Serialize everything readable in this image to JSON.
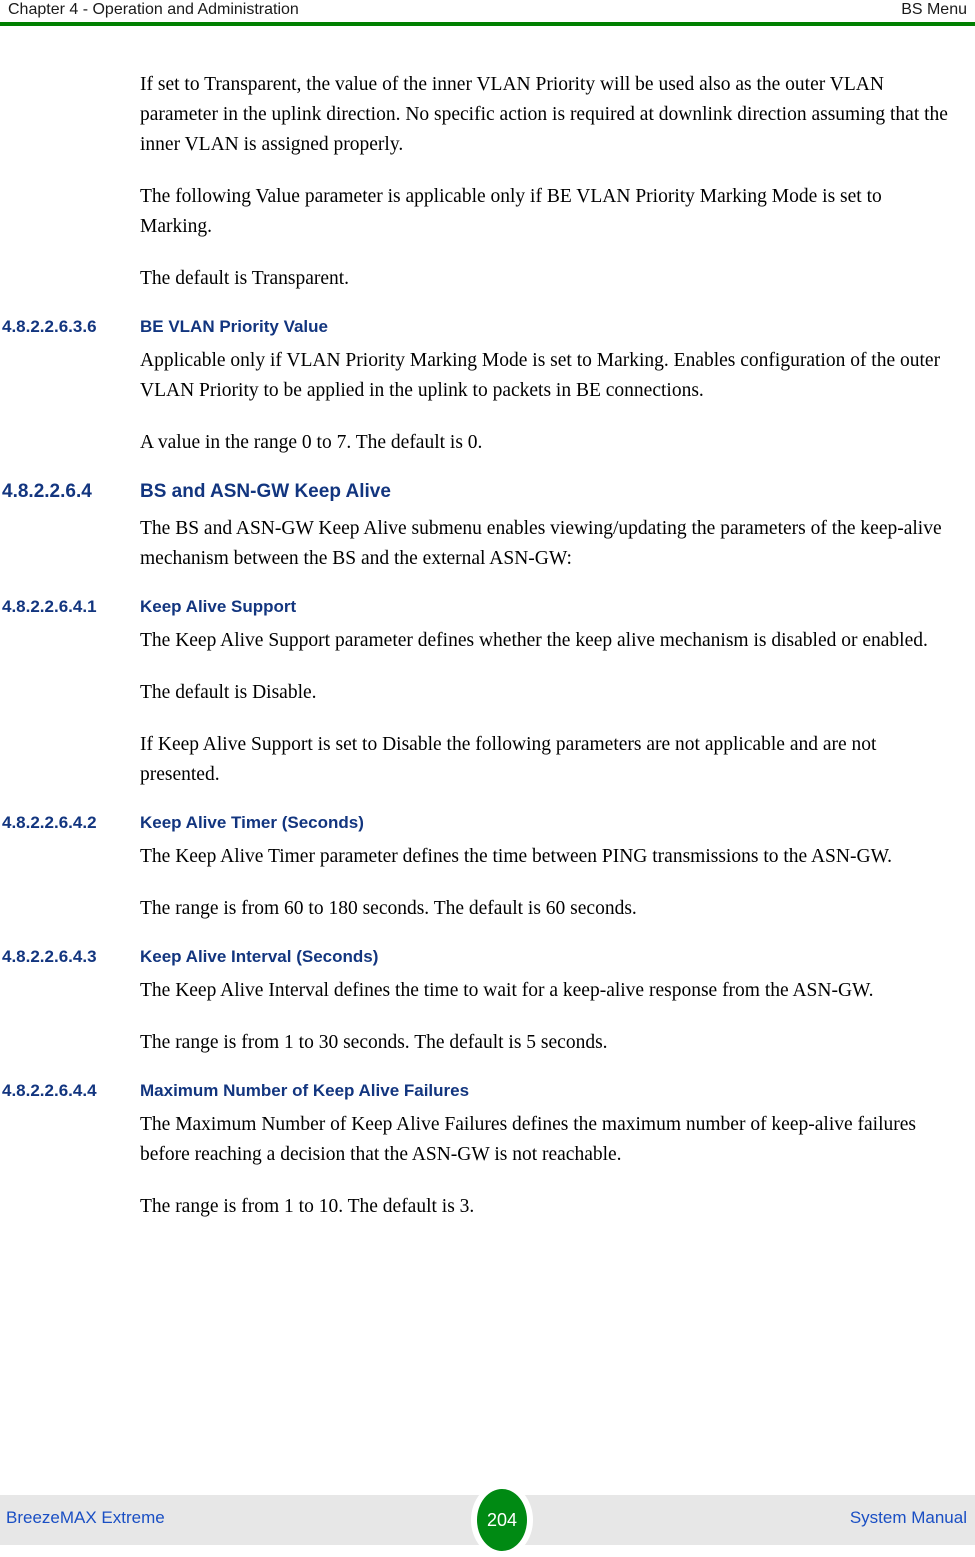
{
  "header": {
    "left": "Chapter 4 - Operation and Administration",
    "right": "BS Menu",
    "rule_color": "#008000"
  },
  "content": {
    "blocks": [
      {
        "kind": "paragraph",
        "text": "If set to Transparent, the value of the inner VLAN Priority will be used also as the outer VLAN parameter in the uplink direction. No specific action is required at downlink direction assuming that the inner VLAN is assigned properly."
      },
      {
        "kind": "paragraph",
        "text": "The following Value parameter is applicable only if BE VLAN Priority Marking Mode is set to Marking."
      },
      {
        "kind": "paragraph",
        "text": "The default is Transparent."
      },
      {
        "kind": "heading",
        "level": 5,
        "number": "4.8.2.2.6.3.6",
        "title": "BE VLAN Priority Value"
      },
      {
        "kind": "paragraph",
        "text": "Applicable only if VLAN Priority Marking Mode is set to Marking. Enables configuration of the outer VLAN Priority to be applied in the uplink to packets in BE connections."
      },
      {
        "kind": "paragraph",
        "text": "A value in the range 0 to 7. The default is 0."
      },
      {
        "kind": "heading",
        "level": 4,
        "number": "4.8.2.2.6.4",
        "title": "BS and ASN-GW Keep Alive"
      },
      {
        "kind": "paragraph",
        "text": "The BS and ASN-GW Keep Alive submenu enables viewing/updating the parameters of the keep-alive mechanism between the BS and the external ASN-GW:"
      },
      {
        "kind": "heading",
        "level": 5,
        "number": "4.8.2.2.6.4.1",
        "title": "Keep Alive Support"
      },
      {
        "kind": "paragraph",
        "text": "The Keep Alive Support parameter defines whether the keep alive mechanism is disabled or enabled."
      },
      {
        "kind": "paragraph",
        "text": "The default is Disable."
      },
      {
        "kind": "paragraph",
        "text": "If Keep Alive Support is set to Disable the following parameters are not applicable and are not presented."
      },
      {
        "kind": "heading",
        "level": 5,
        "number": "4.8.2.2.6.4.2",
        "title": "Keep Alive Timer (Seconds)"
      },
      {
        "kind": "paragraph",
        "text": "The Keep Alive Timer parameter defines the time between PING transmissions to the ASN-GW."
      },
      {
        "kind": "paragraph",
        "text": "The range is from 60 to 180 seconds. The default is 60 seconds."
      },
      {
        "kind": "heading",
        "level": 5,
        "number": "4.8.2.2.6.4.3",
        "title": "Keep Alive Interval (Seconds)"
      },
      {
        "kind": "paragraph",
        "text": "The Keep Alive Interval defines the time to wait for a keep-alive response from the ASN-GW."
      },
      {
        "kind": "paragraph",
        "text": "The range is from 1 to 30 seconds. The default is 5 seconds."
      },
      {
        "kind": "heading",
        "level": 5,
        "number": "4.8.2.2.6.4.4",
        "title": "Maximum Number of Keep Alive Failures"
      },
      {
        "kind": "paragraph",
        "text": "The Maximum Number of Keep Alive Failures defines the maximum number of keep-alive failures before reaching a decision that the ASN-GW is not reachable."
      },
      {
        "kind": "paragraph",
        "text": "The range is from 1 to 10. The default is 3."
      }
    ]
  },
  "footer": {
    "left": "BreezeMAX Extreme",
    "right": "System Manual",
    "page_number": "204",
    "badge_color": "#008a13",
    "band_color": "#e7e7e7",
    "text_color": "#1a4fc4"
  }
}
